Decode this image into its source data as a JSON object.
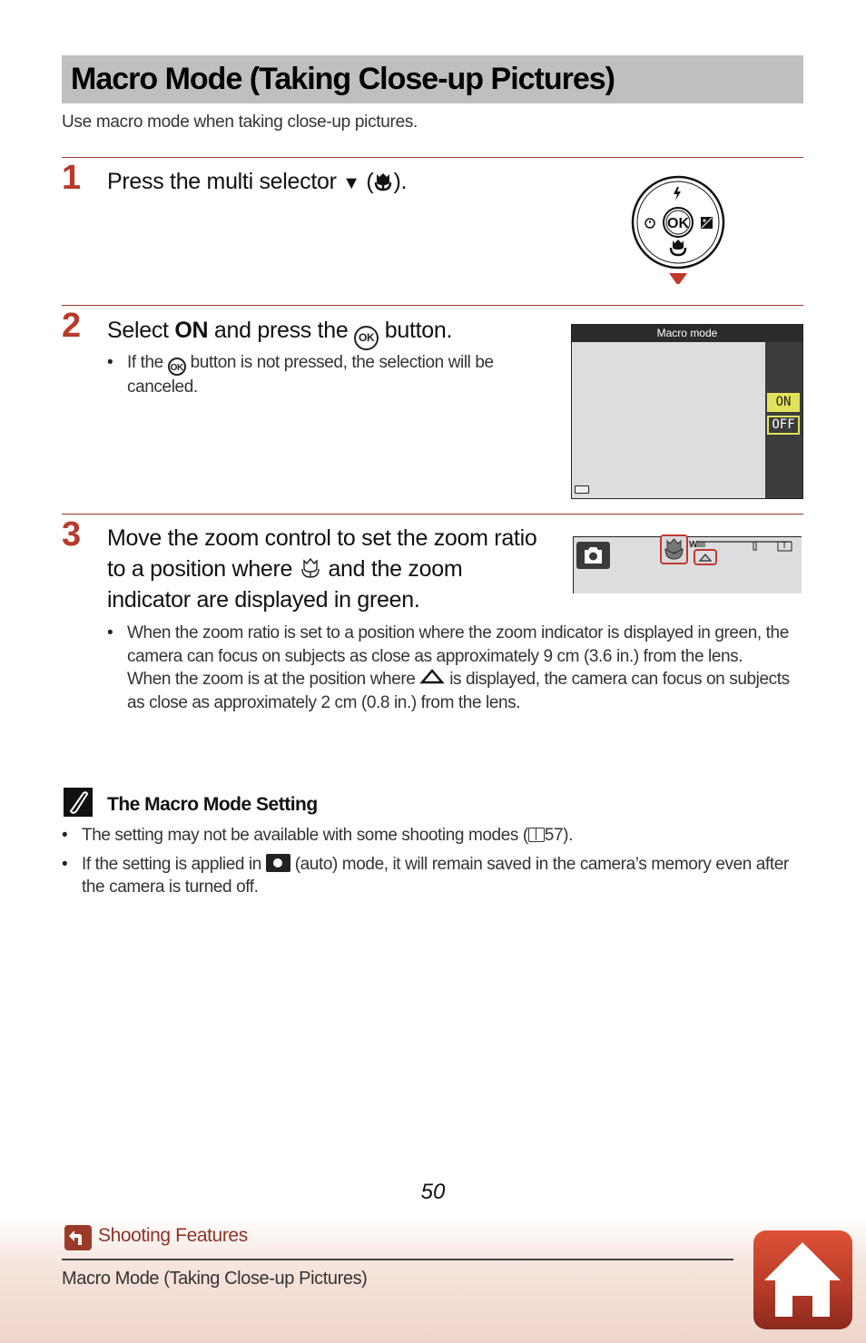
{
  "header": {
    "title": "Macro Mode (Taking Close-up Pictures)",
    "intro": "Use macro mode when taking close-up pictures."
  },
  "steps": [
    {
      "number": "1",
      "text_before": "Press the multi selector ",
      "arrow_glyph": "▼",
      "text_after_open": " (",
      "icon": "macro-flower-icon",
      "text_after_close": ").",
      "illustration": {
        "center_label": "OK",
        "icons": {
          "top": "flash-icon",
          "left": "self-timer-icon",
          "right": "exposure-compensation-icon",
          "bottom": "macro-icon"
        },
        "pointer": "down-arrow-red"
      }
    },
    {
      "number": "2",
      "text_select": "Select ",
      "text_bold": "ON",
      "text_and_press": " and press the ",
      "ok_glyph": "OK",
      "text_button": " button.",
      "bullets": [
        {
          "before": "If the ",
          "ok_glyph": "OK",
          "after": " button is not pressed, the selection will be canceled."
        }
      ],
      "screen": {
        "title": "Macro mode",
        "options": [
          "ON",
          "OFF"
        ],
        "selected": "ON"
      }
    },
    {
      "number": "3",
      "text_line_before": "Move the zoom control to set the zoom ratio to a position where ",
      "icon": "macro-outline-icon",
      "text_line_after": " and the zoom indicator are displayed in green.",
      "bullets": [
        {
          "para1": "When the zoom ratio is set to a position where the zoom indicator is displayed in green, the camera can focus on subjects as close as approximately 9 cm (3.6 in.) from the lens.",
          "para2_before": "When the zoom is at the position where ",
          "para2_icon": "triangle-icon",
          "para2_after": " is displayed, the camera can focus on subjects as close as approximately 2 cm (0.8 in.) from the lens."
        }
      ],
      "zoom_display": {
        "wide_label": "W",
        "tele_label": "T"
      }
    }
  ],
  "note": {
    "title": "The Macro Mode Setting",
    "bullets": [
      {
        "before": "The setting may not be available with some shooting modes (",
        "ref": "57",
        "after": ")."
      },
      {
        "before": "If the setting is applied in ",
        "icon": "camera-auto-icon",
        "after": " (auto) mode, it will remain saved in the camera’s memory even after the camera is turned off."
      }
    ]
  },
  "footer": {
    "page_number": "50",
    "section_link": "Shooting Features",
    "breadcrumb": "Macro Mode (Taking Close-up Pictures)"
  },
  "colors": {
    "accent_red": "#b83a2a",
    "title_bar_gray": "#bfbfbf",
    "lcd_highlight": "#e2e35a"
  }
}
